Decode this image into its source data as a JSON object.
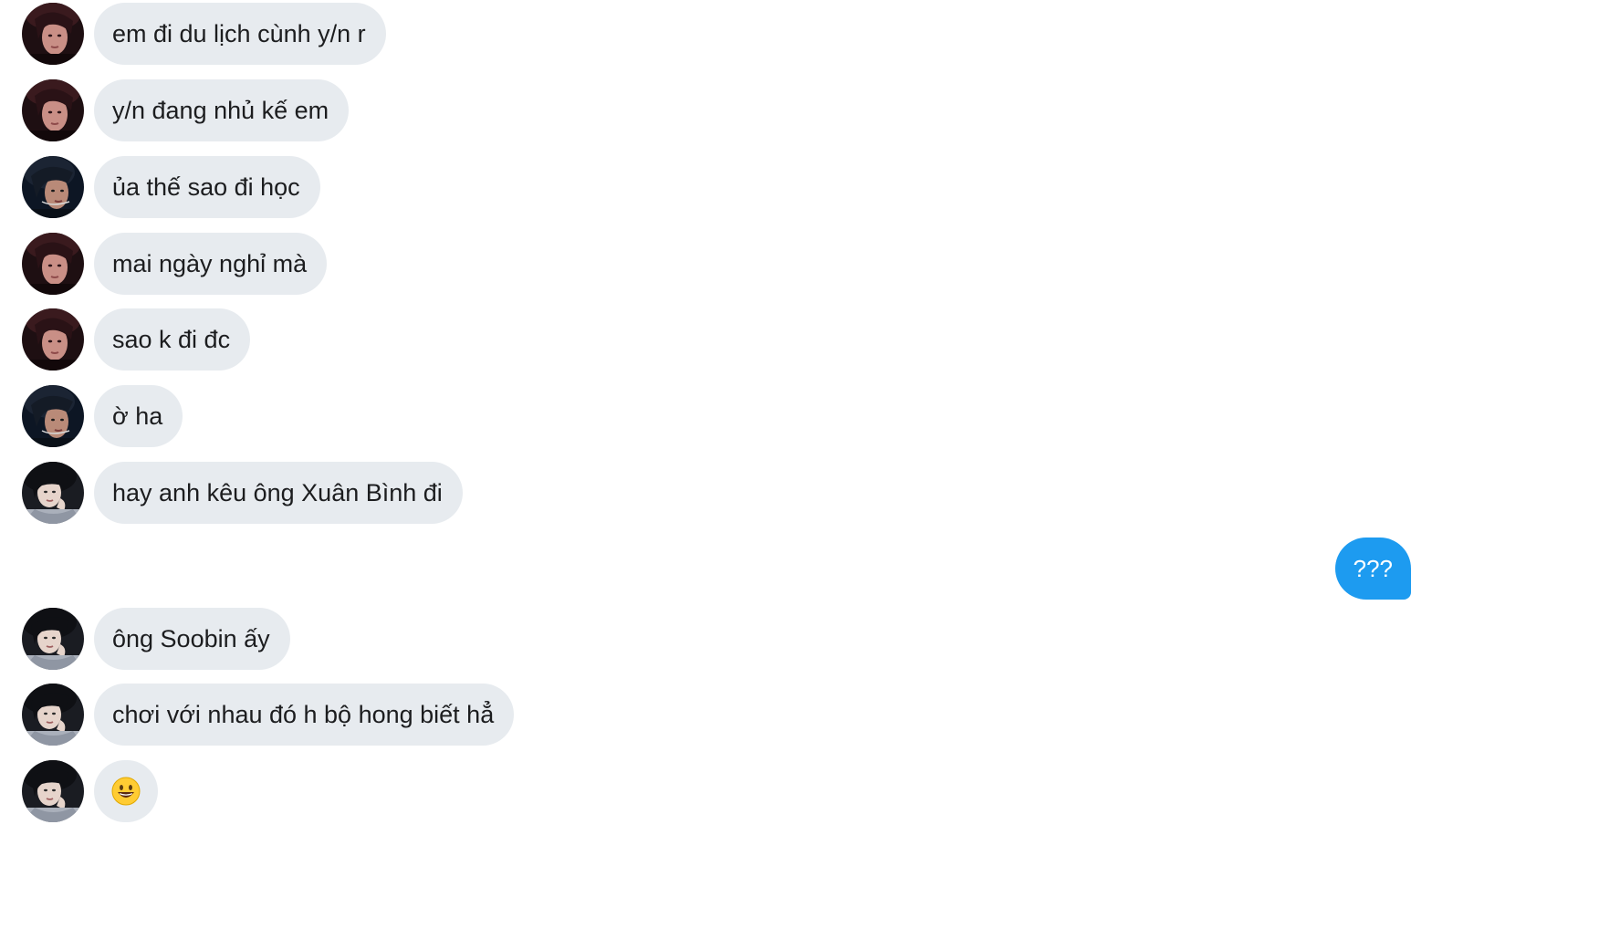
{
  "messages": [
    {
      "sender": "avatar-a",
      "text": "em đi du lịch cùnh y/n r"
    },
    {
      "sender": "avatar-a",
      "text": "y/n đang nhủ kế em"
    },
    {
      "sender": "avatar-b",
      "text": "ủa thế sao đi học"
    },
    {
      "sender": "avatar-a",
      "text": "mai ngày nghỉ mà"
    },
    {
      "sender": "avatar-a",
      "text": "sao k đi đc"
    },
    {
      "sender": "avatar-b",
      "text": "ờ ha"
    },
    {
      "sender": "avatar-c",
      "text": "hay anh kêu ông Xuân Bình đi"
    },
    {
      "sender": "me",
      "text": "???"
    },
    {
      "sender": "avatar-c",
      "text": "ông Soobin ấy"
    },
    {
      "sender": "avatar-c",
      "text": "chơi với nhau đó h bộ hong biết hẳ"
    },
    {
      "sender": "avatar-c",
      "emoji": "grinning-face-emoji"
    }
  ],
  "colors": {
    "incoming_bubble": "#e7ebef",
    "outgoing_bubble": "#1d9bf0",
    "text": "#1c1d1f",
    "background": "#ffffff"
  }
}
